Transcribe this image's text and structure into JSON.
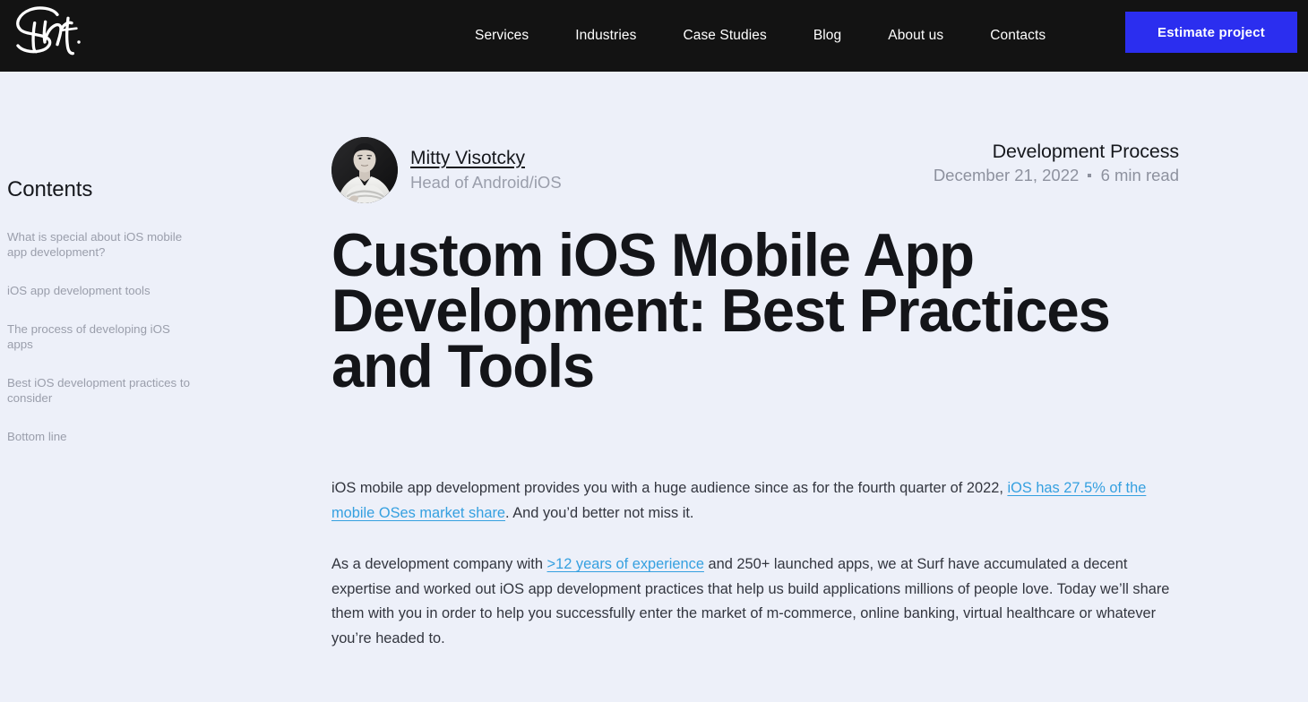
{
  "header": {
    "logo_alt": "Surf",
    "nav": [
      {
        "label": "Services"
      },
      {
        "label": "Industries"
      },
      {
        "label": "Case Studies"
      },
      {
        "label": "Blog"
      },
      {
        "label": "About us"
      },
      {
        "label": "Contacts"
      }
    ],
    "cta_label": "Estimate project",
    "cta_color": "#2b2eef",
    "background": "#131313"
  },
  "sidebar": {
    "title": "Contents",
    "items": [
      {
        "label": "What is special about iOS mobile app development?"
      },
      {
        "label": "iOS app development tools"
      },
      {
        "label": "The process of developing iOS apps"
      },
      {
        "label": "Best iOS development practices to consider"
      },
      {
        "label": "Bottom line"
      }
    ]
  },
  "article": {
    "author": {
      "name": "Mitty Visotcky",
      "role": "Head of Android/iOS",
      "avatar_alt": "Portrait of Mitty Visotcky"
    },
    "category": "Development Process",
    "date": "December 21, 2022",
    "read_time": "6 min read",
    "title": "Custom iOS Mobile App Development: Best Practices and Tools",
    "paragraphs": [
      {
        "parts": [
          {
            "type": "text",
            "text": "iOS mobile app development provides you with a huge audience since as for the fourth quarter of 2022, "
          },
          {
            "type": "link",
            "text": "iOS has 27.5% of the mobile OSes market share"
          },
          {
            "type": "text",
            "text": ". And you’d better not miss it."
          }
        ]
      },
      {
        "parts": [
          {
            "type": "text",
            "text": "As a development company with "
          },
          {
            "type": "link",
            "text": ">12 years of experience"
          },
          {
            "type": "text",
            "text": " and 250+ launched apps, we at Surf have accumulated a decent expertise and worked out iOS app development practices that help us build applications millions of people love. Today we’ll share them with you in order to help you successfully enter the market of m-commerce, online banking, virtual healthcare or whatever you’re headed to."
          }
        ]
      }
    ]
  },
  "theme": {
    "page_background": "#edf0f9",
    "link_color": "#35a0e0",
    "text_color": "#33363f",
    "muted_color": "#9a9eab"
  }
}
